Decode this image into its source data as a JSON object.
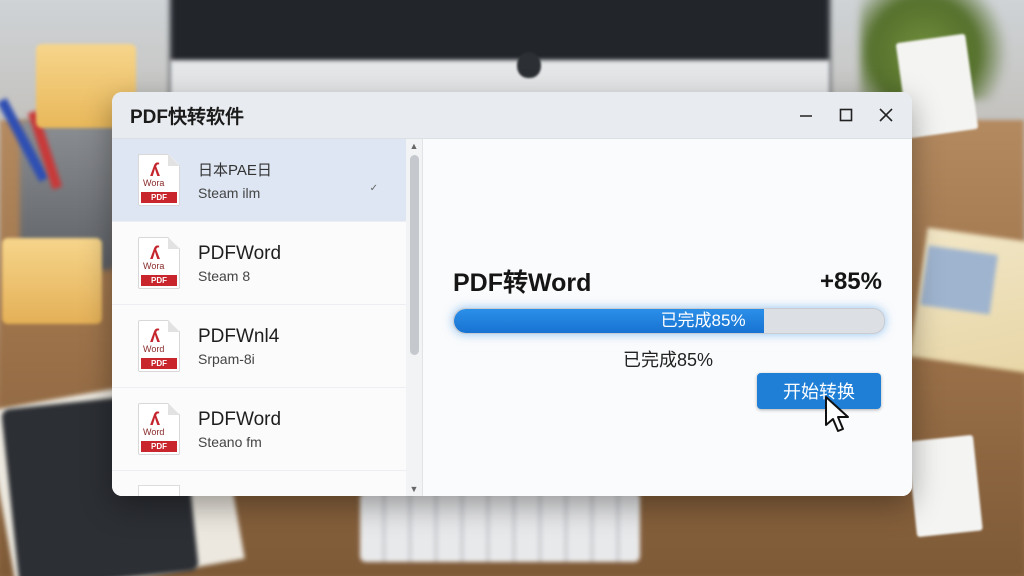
{
  "window": {
    "title": "PDF快转软件",
    "controls": {
      "minimize_icon": "minimize-icon",
      "maximize_icon": "maximize-icon",
      "close_icon": "close-icon"
    }
  },
  "file_list": {
    "items": [
      {
        "name": "日本PAE日",
        "subtitle": "Steam ilm",
        "selected": true,
        "badge": "PDF",
        "icon_text": "Wora"
      },
      {
        "name": "PDFWord",
        "subtitle": "Steam 8",
        "selected": false,
        "badge": "PDF",
        "icon_text": "Wora"
      },
      {
        "name": "PDFWnl4",
        "subtitle": "Srpam-8i",
        "selected": false,
        "badge": "PDF",
        "icon_text": "Word"
      },
      {
        "name": "PDFWord",
        "subtitle": "Steano fm",
        "selected": false,
        "badge": "PDF",
        "icon_text": "Word"
      }
    ]
  },
  "task": {
    "title": "PDF转Word",
    "percent_label": "+85%",
    "progress_value": 0.72,
    "progress_text": "已完成85%",
    "status_text": "已完成85%",
    "start_button_label": "开始转换"
  },
  "colors": {
    "accent": "#1f7fd6",
    "progress_fill": "#1873d2",
    "pdf_red": "#c9252c",
    "selected_row": "#dde6f2"
  }
}
